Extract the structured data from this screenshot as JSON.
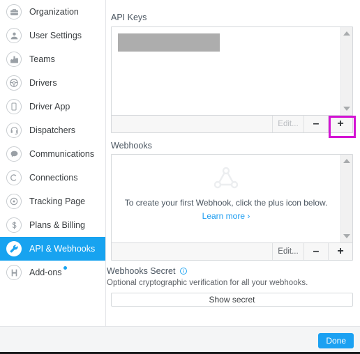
{
  "sidebar": {
    "items": [
      {
        "label": "Organization",
        "icon": "briefcase-icon",
        "selected": false,
        "badge": false
      },
      {
        "label": "User Settings",
        "icon": "person-icon",
        "selected": false,
        "badge": false
      },
      {
        "label": "Teams",
        "icon": "factory-icon",
        "selected": false,
        "badge": false
      },
      {
        "label": "Drivers",
        "icon": "steering-wheel-icon",
        "selected": false,
        "badge": false
      },
      {
        "label": "Driver App",
        "icon": "mobile-phone-icon",
        "selected": false,
        "badge": false
      },
      {
        "label": "Dispatchers",
        "icon": "headset-icon",
        "selected": false,
        "badge": false
      },
      {
        "label": "Communications",
        "icon": "chat-bubble-icon",
        "selected": false,
        "badge": false
      },
      {
        "label": "Connections",
        "icon": "letter-c-icon",
        "selected": false,
        "badge": false
      },
      {
        "label": "Tracking Page",
        "icon": "target-icon",
        "selected": false,
        "badge": false
      },
      {
        "label": "Plans & Billing",
        "icon": "dollar-icon",
        "selected": false,
        "badge": false
      },
      {
        "label": "API & Webhooks",
        "icon": "wrench-icon",
        "selected": true,
        "badge": false
      },
      {
        "label": "Add-ons",
        "icon": "puzzle-icon",
        "selected": false,
        "badge": true
      }
    ]
  },
  "main": {
    "api_keys": {
      "label": "API Keys",
      "redacted_entry": "",
      "toolbar": {
        "edit_label": "Edit...",
        "edit_disabled": true,
        "remove_label": "–",
        "add_label": "+"
      }
    },
    "webhooks": {
      "label": "Webhooks",
      "empty_icon": "webhook-icon",
      "empty_text": "To create your first Webhook, click the plus icon below.",
      "learn_more_label": "Learn more ›",
      "toolbar": {
        "edit_label": "Edit...",
        "edit_disabled": false,
        "remove_label": "–",
        "add_label": "+"
      }
    },
    "webhooks_secret": {
      "label": "Webhooks Secret",
      "info_icon": "info-icon",
      "description": "Optional cryptographic verification for all your webhooks.",
      "button_label": "Show secret"
    }
  },
  "footer": {
    "done_label": "Done"
  },
  "annotation": {
    "target": "api-keys-add-button",
    "color": "#d313d3"
  },
  "colors": {
    "accent": "#17a3f0",
    "highlight": "#d313d3",
    "redaction": "#adadad",
    "link": "#1a9bf0"
  }
}
